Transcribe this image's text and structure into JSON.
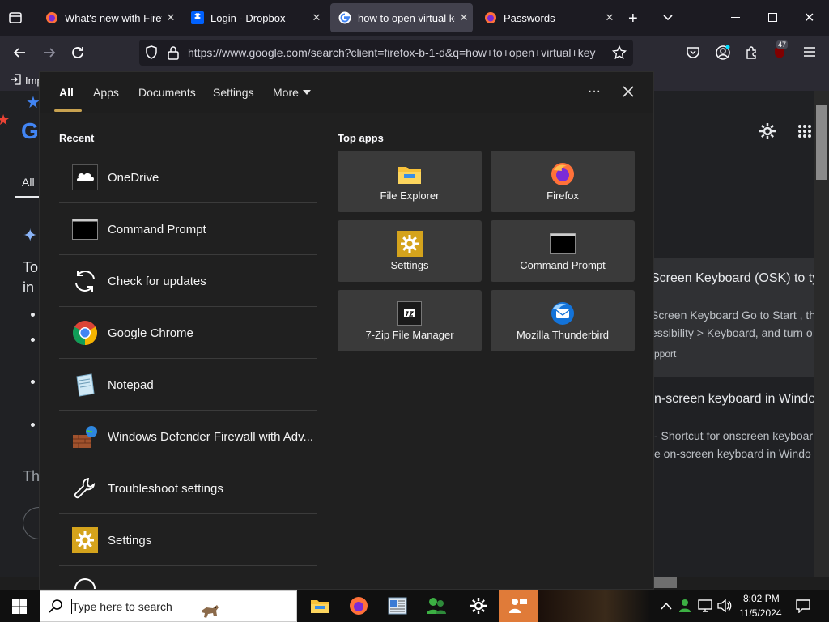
{
  "browser": {
    "tabs": [
      {
        "title": "What's new with Firefo",
        "active": false
      },
      {
        "title": "Login - Dropbox",
        "active": false
      },
      {
        "title": "how to open virtual ke",
        "active": true
      },
      {
        "title": "Passwords",
        "active": false
      }
    ],
    "url": "https://www.google.com/search?client=firefox-b-1-d&q=how+to+open+virtual+key",
    "extension_badge": "47",
    "bookmark_first": "Imp"
  },
  "webpage": {
    "logo_partial": "G",
    "tab_all": "All",
    "text_to": "To",
    "text_in": "in",
    "text_th": "Th",
    "result1_title": "Screen Keyboard (OSK) to ty",
    "result1_snip1": "Screen Keyboard Go to Start , th",
    "result1_snip2": "essibility > Keyboard, and turn o",
    "result1_source": "pport",
    "result2_title": "n-screen keyboard in Windo",
    "result2_snip1": "- Shortcut for onscreen keyboar",
    "result2_snip2": "e on-screen keyboard in Windo"
  },
  "start_panel": {
    "tabs": [
      "All",
      "Apps",
      "Documents",
      "Settings",
      "More"
    ],
    "recent_label": "Recent",
    "top_apps_label": "Top apps",
    "recent": [
      {
        "label": "OneDrive",
        "icon": "onedrive-icon"
      },
      {
        "label": "Command Prompt",
        "icon": "command-prompt-icon"
      },
      {
        "label": "Check for updates",
        "icon": "refresh-icon"
      },
      {
        "label": "Google Chrome",
        "icon": "chrome-icon"
      },
      {
        "label": "Notepad",
        "icon": "notepad-icon"
      },
      {
        "label": "Windows Defender Firewall with Adv...",
        "icon": "firewall-icon"
      },
      {
        "label": "Troubleshoot settings",
        "icon": "wrench-icon"
      },
      {
        "label": "Settings",
        "icon": "gear-icon"
      }
    ],
    "top_apps": [
      {
        "label": "File Explorer",
        "icon": "folder-icon"
      },
      {
        "label": "Firefox",
        "icon": "firefox-icon"
      },
      {
        "label": "Settings",
        "icon": "gear-icon"
      },
      {
        "label": "Command Prompt",
        "icon": "command-prompt-icon"
      },
      {
        "label": "7-Zip File Manager",
        "icon": "7zip-icon"
      },
      {
        "label": "Mozilla Thunderbird",
        "icon": "thunderbird-icon"
      }
    ]
  },
  "taskbar": {
    "search_placeholder": "Type here to search",
    "time": "8:02 PM",
    "date": "11/5/2024"
  }
}
